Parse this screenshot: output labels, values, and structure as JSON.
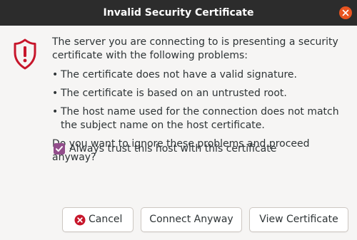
{
  "window": {
    "title": "Invalid Security Certificate"
  },
  "dialog": {
    "intro": "The server you are connecting to is presenting a security certificate with the following problems:",
    "problems": [
      "The certificate does not have a valid signature.",
      "The certificate is based on an untrusted root.",
      "The host name used for the connection does not match the subject name on the host certificate."
    ],
    "bullet_glyph": "•",
    "question": "Do you want to ignore these problems and proceed anyway?",
    "checkbox": {
      "label": "Always trust this host with this certificate",
      "checked": true
    }
  },
  "buttons": {
    "cancel": "Cancel",
    "connect": "Connect Anyway",
    "view": "View Certificate"
  },
  "icons": {
    "window_close": "close-icon",
    "warning": "shield-warning-icon",
    "cancel": "cancel-icon",
    "checkbox_mark": "checkmark-icon"
  },
  "colors": {
    "titlebar": "#2c2c2c",
    "close_button": "#e95420",
    "shield": "#c7162b",
    "checkbox": "#924d8b",
    "background": "#f6f5f4"
  }
}
